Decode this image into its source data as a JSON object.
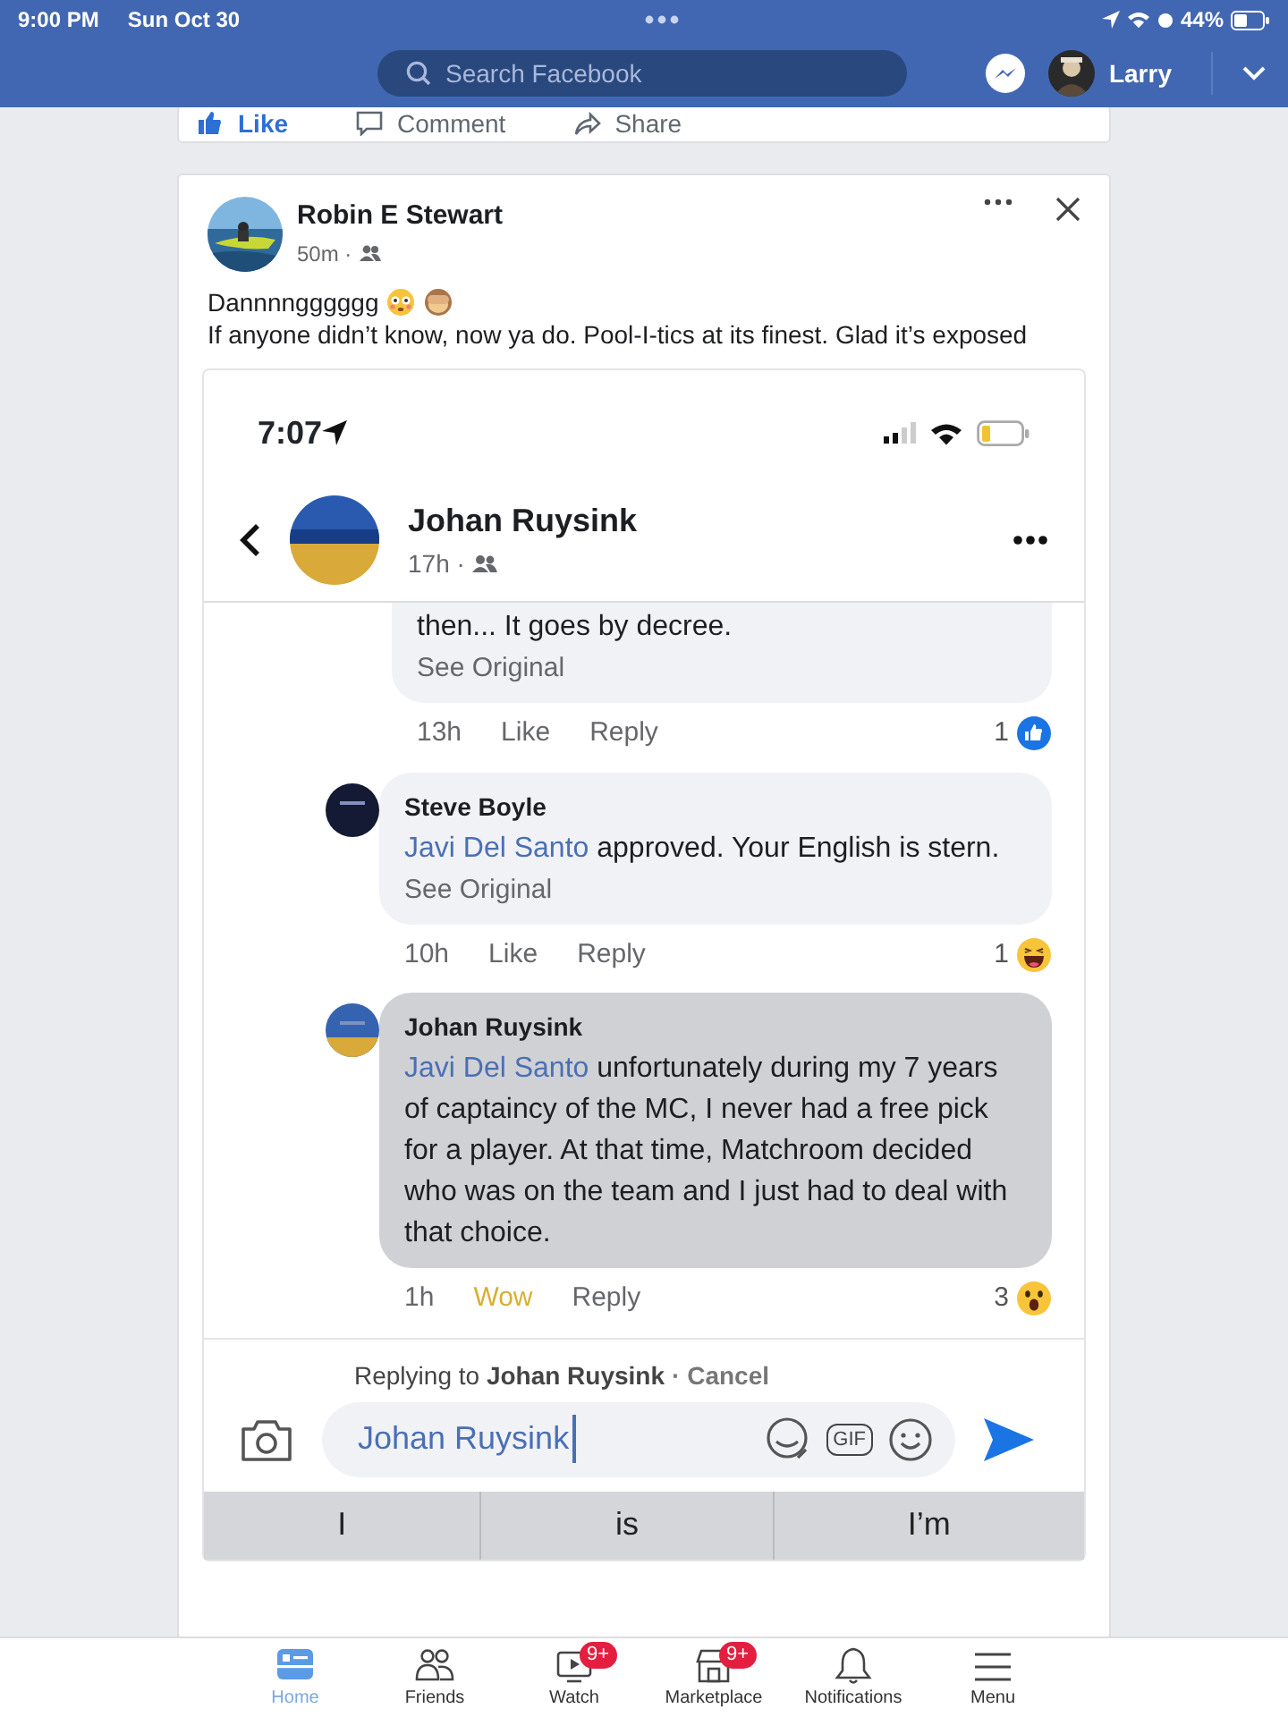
{
  "status_bar": {
    "time": "9:00 PM",
    "date": "Sun Oct 30",
    "battery": "44%"
  },
  "header": {
    "search": {
      "placeholder": "Search Facebook"
    },
    "user": "Larry"
  },
  "previous_post_actions": [
    {
      "label": "Like",
      "selected": true
    },
    {
      "label": "Comment",
      "selected": false
    },
    {
      "label": "Share",
      "selected": false
    }
  ],
  "post": {
    "author": "Robin E Stewart",
    "time": "50m ·",
    "lines": [
      "Dannnngggggg",
      "If anyone didn’t know, now ya do. Pool-I-tics at its finest. Glad it’s exposed"
    ],
    "screenshot": {
      "time": "7:07",
      "post_author": "Johan Ruysink",
      "post_time": "17h ·",
      "comments": [
        {
          "text": "then... It goes by decree.",
          "see_original": "See Original",
          "time": "13h",
          "like": "Like",
          "reacted": false,
          "reply": "Reply",
          "count": "1",
          "kind": "like",
          "highlighted": false
        },
        {
          "author": "Steve Boyle",
          "color": "#141a33",
          "mention": "Javi Del Santo",
          "text": " approved. Your English is stern.",
          "see_original": "See Original",
          "time": "10h",
          "like": "Like",
          "reacted": false,
          "reply": "Reply",
          "count": "1",
          "kind": "haha",
          "highlighted": false
        },
        {
          "author": "Johan Ruysink",
          "color": "#3563b0",
          "mention": "Javi Del Santo",
          "text": " unfortunately during my 7 years of captaincy of the MC, I never had a free pick for a player. At that time, Matchroom decided who was on the team and I just had to deal with that choice.",
          "time": "1h",
          "like": "Wow",
          "reacted": true,
          "reply": "Reply",
          "count": "3",
          "kind": "wow",
          "highlighted": true
        }
      ],
      "replying": "Replying to **Johan Ruysink**",
      "cancel": "· Cancel",
      "composer_value": "Johan Ruysink",
      "gif": "GIF",
      "suggestions": [
        "I",
        "is",
        "I’m"
      ]
    }
  },
  "bottom_nav": [
    {
      "label": "Home",
      "selected": true
    },
    {
      "label": "Friends",
      "selected": false
    },
    {
      "label": "Watch",
      "selected": false,
      "badge": "9+"
    },
    {
      "label": "Marketplace",
      "selected": false,
      "badge": "9+"
    },
    {
      "label": "Notifications",
      "selected": false
    },
    {
      "label": "Menu",
      "selected": false
    }
  ]
}
